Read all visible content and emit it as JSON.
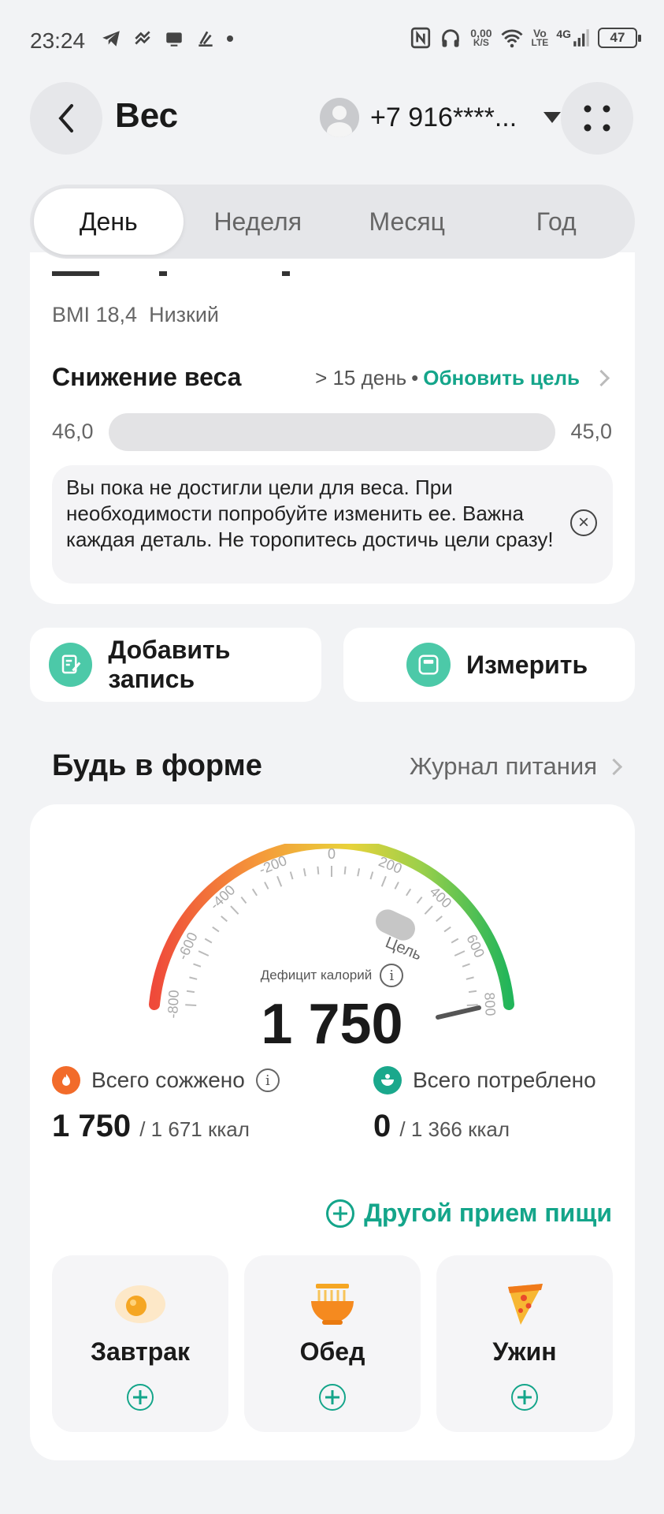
{
  "status_bar": {
    "time": "23:24",
    "net_speed": "0,00",
    "net_unit": "K/S",
    "volte_top": "Vo",
    "volte_bottom": "LTE",
    "network": "4G",
    "battery": "47"
  },
  "header": {
    "title": "Вес",
    "account": "+7 916****...",
    "icons": [
      "back-arrow-icon",
      "apps-icon",
      "chevron-down-icon"
    ]
  },
  "tabs": [
    {
      "label": "День",
      "active": true
    },
    {
      "label": "Неделя",
      "active": false
    },
    {
      "label": "Месяц",
      "active": false
    },
    {
      "label": "Год",
      "active": false
    }
  ],
  "weight": {
    "bmi_label": "BMI 18,4",
    "bmi_status": "Низкий",
    "goal_title": "Снижение веса",
    "goal_days": "> 15 день",
    "goal_sep": "•",
    "update_goal": "Обновить цель",
    "start_value": "46,0",
    "target_value": "45,0",
    "note": "Вы пока не достигли цели для веса. При необходимости попробуйте изменить ее. Важна каждая деталь. Не торопитесь достичь цели сразу!"
  },
  "actions": {
    "add_record": "Добавить запись",
    "measure": "Измерить"
  },
  "fit": {
    "title": "Будь в форме",
    "journal": "Журнал питания",
    "gauge_ticks": [
      "-800",
      "-600",
      "-400",
      "-200",
      "0",
      "200",
      "400",
      "600",
      "800"
    ],
    "goal_label": "Цель",
    "deficit_label": "Дефицит калорий",
    "deficit_value": "1 750",
    "burned_label": "Всего сожжено",
    "burned_value": "1 750",
    "burned_total": "/ 1 671 ккал",
    "consumed_label": "Всего потреблено",
    "consumed_value": "0",
    "consumed_total": "/ 1 366 ккал",
    "other_meal": "Другой прием пищи",
    "meals": [
      {
        "label": "Завтрак",
        "icon": "egg-icon"
      },
      {
        "label": "Обед",
        "icon": "noodle-bowl-icon"
      },
      {
        "label": "Ужин",
        "icon": "pizza-icon"
      }
    ],
    "colors": {
      "accent": "#14a58a",
      "burned": "#f26b2a",
      "consumed": "#1aa88c"
    }
  }
}
